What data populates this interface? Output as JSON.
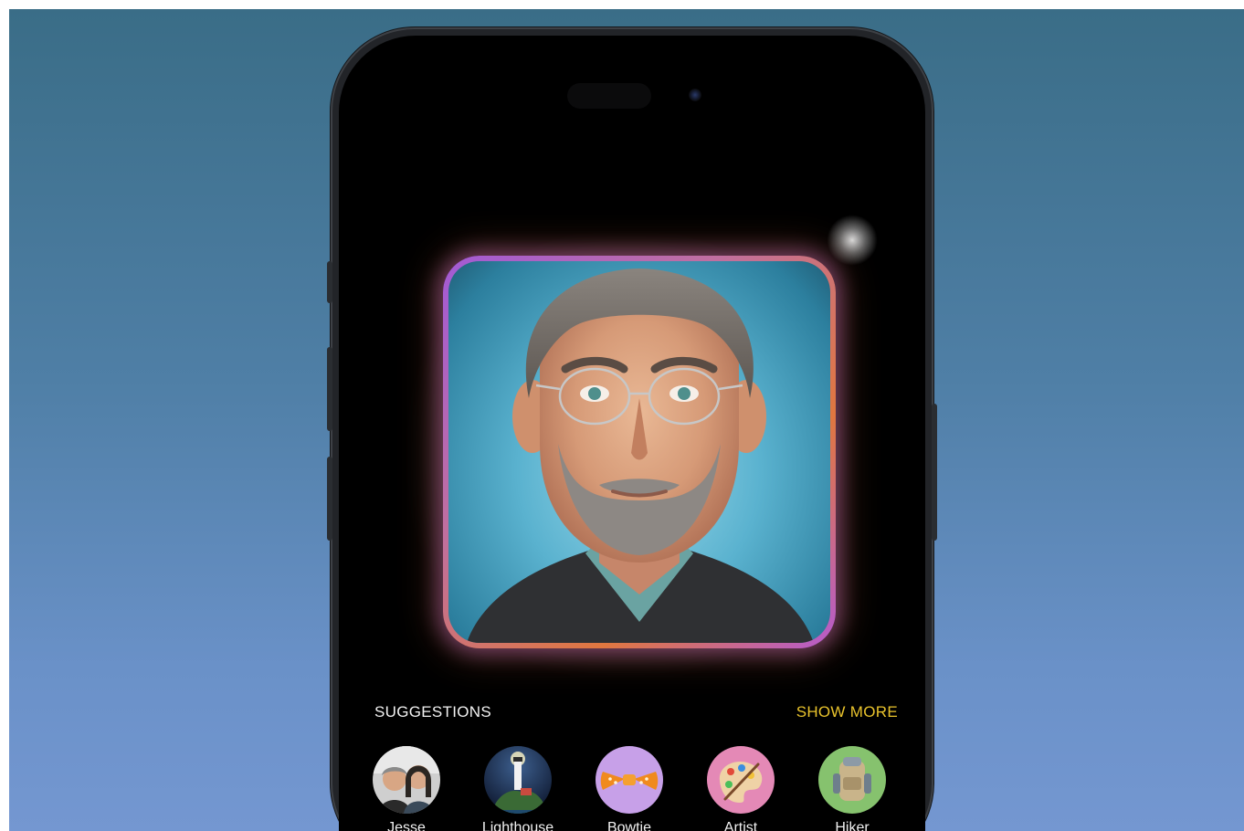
{
  "suggestions_section": {
    "title": "SUGGESTIONS",
    "show_more_label": "SHOW MORE",
    "accent_color": "#e9c32c"
  },
  "suggestions": [
    {
      "label": "Jesse",
      "icon": "people-photo-icon",
      "bg": "#d9d9d9"
    },
    {
      "label": "Lighthouse",
      "icon": "lighthouse-icon",
      "bg": "#1d3558"
    },
    {
      "label": "Bowtie",
      "icon": "bowtie-icon",
      "bg": "#c7a0e8"
    },
    {
      "label": "Artist",
      "icon": "artist-palette-icon",
      "bg": "#e489b6"
    },
    {
      "label": "Hiker",
      "icon": "backpack-icon",
      "bg": "#86c26e"
    }
  ],
  "portrait": {
    "icon": "generated-portrait-image",
    "frame_colors": [
      "#a25ad6",
      "#e0773f"
    ]
  }
}
